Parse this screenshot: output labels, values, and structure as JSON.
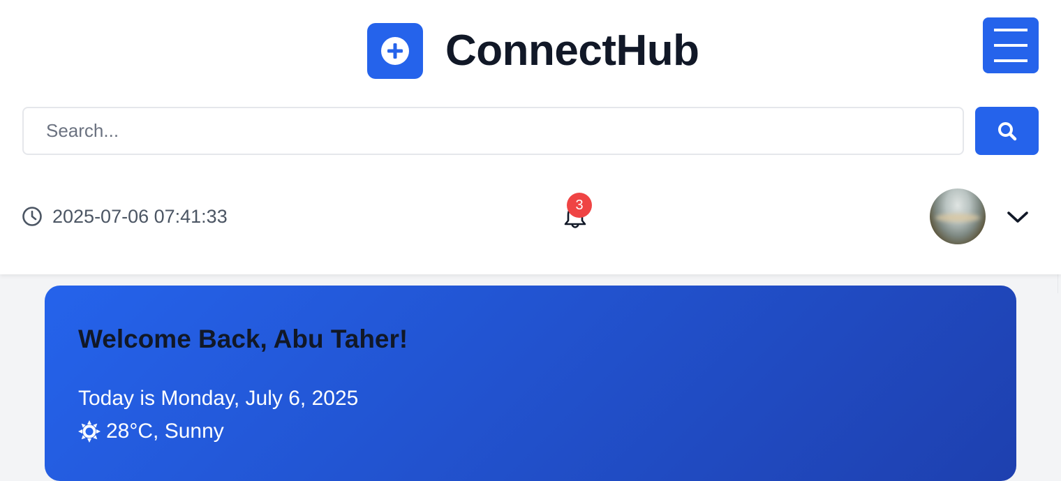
{
  "brand": {
    "name": "ConnectHub",
    "logo_icon": "plus-circle-icon"
  },
  "menu": {
    "icon": "hamburger-icon"
  },
  "search": {
    "placeholder": "Search...",
    "value": "",
    "button_icon": "search-icon"
  },
  "status": {
    "datetime": "2025-07-06 07:41:33",
    "clock_icon": "clock-icon",
    "notifications": {
      "icon": "bell-icon",
      "count": "3"
    }
  },
  "user": {
    "avatar_icon": "avatar",
    "dropdown_icon": "chevron-down-icon"
  },
  "welcome": {
    "title": "Welcome Back, Abu Taher!",
    "today": "Today is Monday, July 6, 2025",
    "weather_icon": "sun-icon",
    "weather": "28°C, Sunny"
  },
  "colors": {
    "accent": "#2563eb",
    "accent_dark": "#1e40af",
    "badge": "#ef4444",
    "text_dark": "#111827",
    "text_muted": "#4b5563",
    "page_bg": "#f3f4f6"
  }
}
